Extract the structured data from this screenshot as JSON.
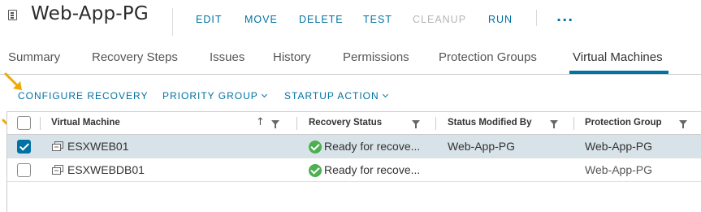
{
  "header": {
    "title": "Web-App-PG",
    "actions": [
      {
        "label": "EDIT",
        "enabled": true
      },
      {
        "label": "MOVE",
        "enabled": true
      },
      {
        "label": "DELETE",
        "enabled": true
      },
      {
        "label": "TEST",
        "enabled": true
      },
      {
        "label": "CLEANUP",
        "enabled": false
      },
      {
        "label": "RUN",
        "enabled": true
      }
    ],
    "more": "···"
  },
  "tabs": [
    {
      "label": "Summary",
      "active": false
    },
    {
      "label": "Recovery Steps",
      "active": false
    },
    {
      "label": "Issues",
      "active": false
    },
    {
      "label": "History",
      "active": false
    },
    {
      "label": "Permissions",
      "active": false
    },
    {
      "label": "Protection Groups",
      "active": false
    },
    {
      "label": "Virtual Machines",
      "active": true
    }
  ],
  "toolbar": {
    "configure_recovery": "CONFIGURE RECOVERY",
    "priority_group": "PRIORITY GROUP",
    "startup_action": "STARTUP ACTION"
  },
  "grid": {
    "columns": [
      "Virtual Machine",
      "Recovery Status",
      "Status Modified By",
      "Protection Group"
    ],
    "sort": "ascending",
    "rows": [
      {
        "selected": true,
        "vm": "ESXWEB01",
        "status": "Ready for recove...",
        "modified_by": "Web-App-PG",
        "group": "Web-App-PG"
      },
      {
        "selected": false,
        "vm": "ESXWEBDB01",
        "status": "Ready for recove...",
        "modified_by": "",
        "group": "Web-App-PG"
      }
    ]
  },
  "colors": {
    "accent": "#0072a3",
    "selected_row": "#d8e3e9",
    "status_ok": "#4caf50",
    "annotation_arrow": "#f0a800"
  }
}
